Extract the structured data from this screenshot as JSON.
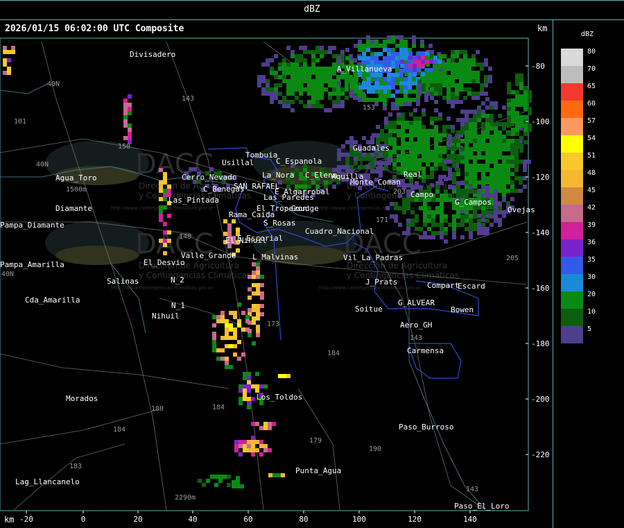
{
  "title": "dBZ",
  "header": "2026/01/15 06:02:00 UTC Composite",
  "km_top": "km",
  "km_bottom": "km",
  "legend": {
    "title": "dBZ",
    "items": [
      {
        "value": "80",
        "color": "#d9d9d9"
      },
      {
        "value": "70",
        "color": "#bdbdbd"
      },
      {
        "value": "65",
        "color": "#f33a2e"
      },
      {
        "value": "60",
        "color": "#ff6a10"
      },
      {
        "value": "57",
        "color": "#ff9860"
      },
      {
        "value": "54",
        "color": "#ffff00"
      },
      {
        "value": "51",
        "color": "#f8c82c"
      },
      {
        "value": "48",
        "color": "#f3b732"
      },
      {
        "value": "45",
        "color": "#ce8a40"
      },
      {
        "value": "42",
        "color": "#c86a8f"
      },
      {
        "value": "39",
        "color": "#d0209a"
      },
      {
        "value": "36",
        "color": "#7a22cc"
      },
      {
        "value": "35",
        "color": "#3359e8"
      },
      {
        "value": "30",
        "color": "#1a8ad8"
      },
      {
        "value": "20",
        "color": "#0b8a13"
      },
      {
        "value": "10",
        "color": "#0b5e0f"
      },
      {
        "value": "5",
        "color": "#4f3d8d"
      }
    ]
  },
  "x_axis": {
    "ticks": [
      "-20",
      "0",
      "20",
      "40",
      "60",
      "80",
      "100",
      "120",
      "140"
    ]
  },
  "y_axis": {
    "ticks": [
      "-80",
      "-100",
      "-120",
      "-140",
      "-160",
      "-180",
      "-200",
      "-220"
    ]
  },
  "places": [
    "Divisadero",
    "A_Villanueva",
    "Tombuia",
    "C_Espanola",
    "Usillal",
    "La_Nora",
    "C_Elena",
    "Aquilla",
    "Agua_Toro",
    "Cerro_Nevado",
    "SAN_RAFAEL",
    "E_Algarrobal",
    "C_Benegas",
    "Rama_Caida",
    "El_Tropezon",
    "Goudge",
    "Las_Paredes",
    "Las_Pintada",
    "Ovejas",
    "Pampa_Diamante",
    "S_Rosas",
    "Monte_Coman",
    "El_Nihuil",
    "G_Campos",
    "Cuadro_Nacional",
    "Valle_Grande",
    "E_Escorial",
    "Pampa_Amarilla",
    "Salinas",
    "N_1",
    "N_2",
    "Nihuil",
    "El_Desvio",
    "L_Malvinas",
    "Vil_La_Padras",
    "J_Prats",
    "Compart",
    "Escard",
    "G_ALVEAR",
    "Bowen",
    "Soitue",
    "Aero_GH",
    "Carmensa",
    "Los_Toldos",
    "Morados",
    "Paso_Burroso",
    "Punta_Agua",
    "Lag_Llancanelo",
    "Paso_El_Loro",
    "Cda_Amarilla",
    "Guadales",
    "Campo",
    "Diamante",
    "Real"
  ],
  "route_numbers": [
    "143",
    "101",
    "40N",
    "40N",
    "40N",
    "150",
    "148",
    "171",
    "173",
    "180",
    "184",
    "184",
    "179",
    "183",
    "184",
    "190",
    "143",
    "143",
    "205",
    "203",
    "153",
    "2290m",
    "1500m"
  ],
  "watermark": "DACC",
  "watermark_sub": [
    "Dirección de Agricultura",
    "y Contingencias Climáticas"
  ],
  "watermark_url": "http://www.contingencias.mendoza.gov.ar"
}
